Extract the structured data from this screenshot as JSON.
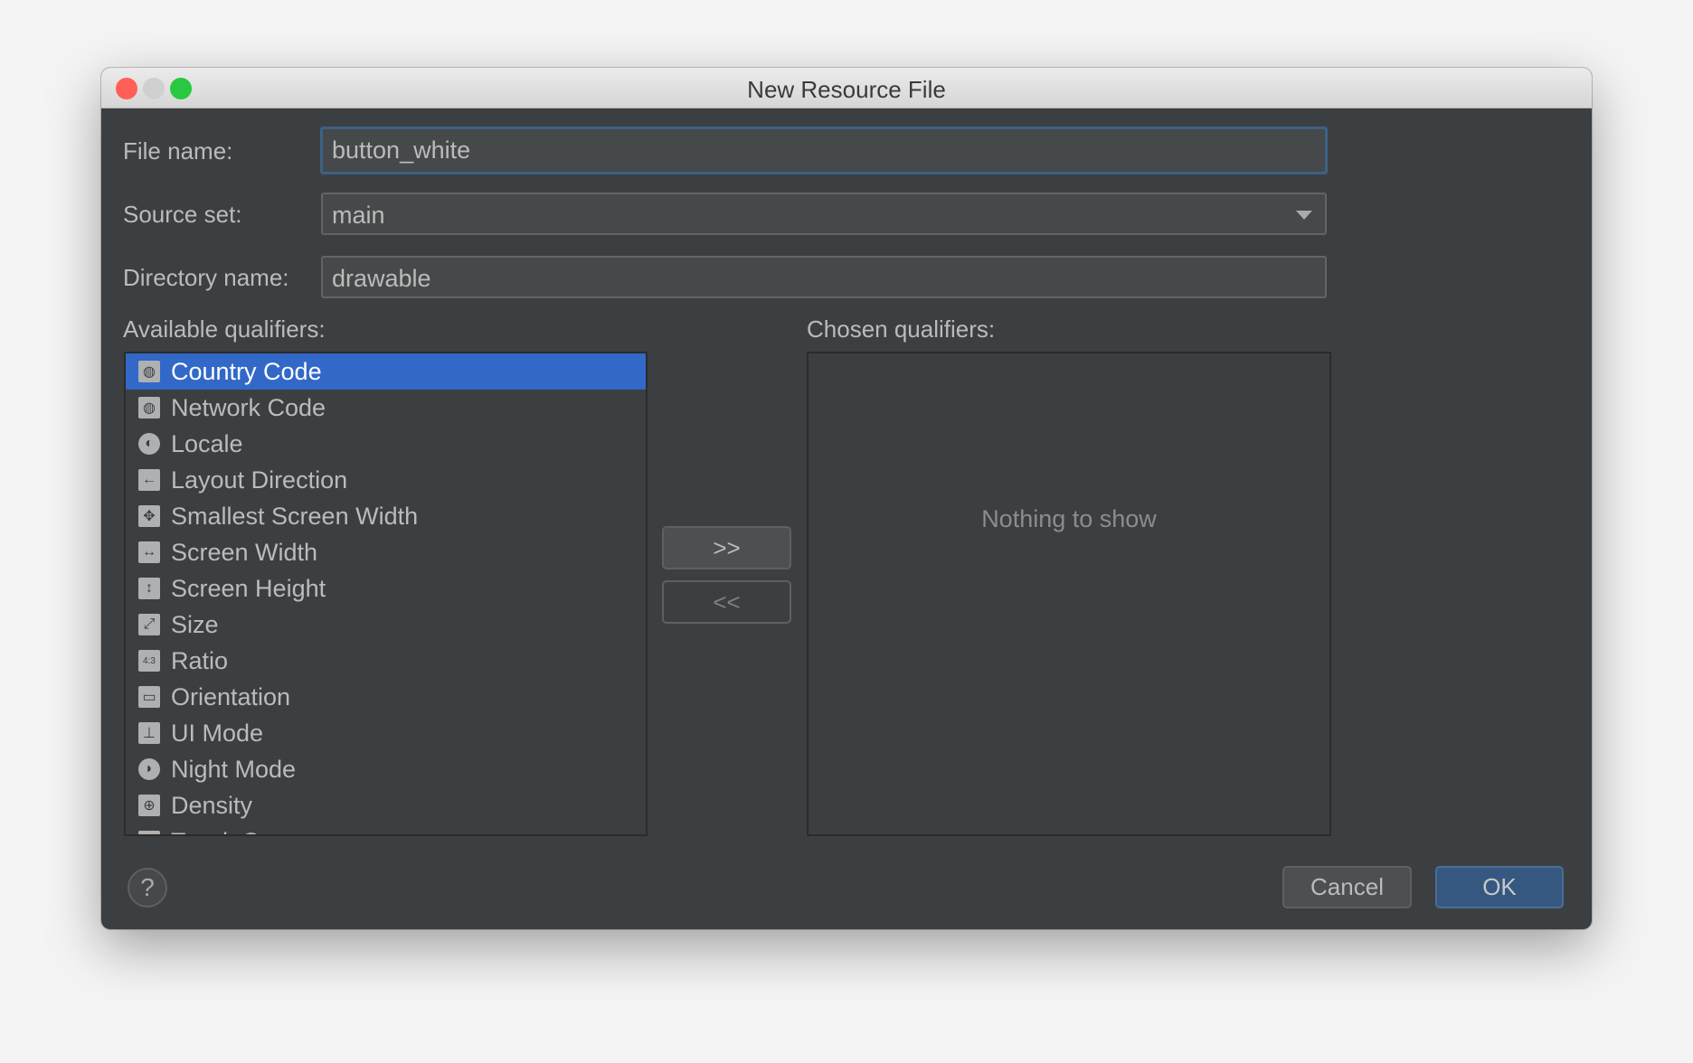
{
  "window": {
    "title": "New Resource File",
    "controls": {
      "close": "#ff5f57",
      "minimize": "#d0d0d0",
      "maximize": "#28c840"
    }
  },
  "form": {
    "file_name": {
      "label": "File name:",
      "value": "button_white"
    },
    "source_set": {
      "label": "Source set:",
      "value": "main"
    },
    "directory_name": {
      "label": "Directory name:",
      "value": "drawable"
    }
  },
  "available": {
    "label": "Available qualifiers:",
    "items": [
      {
        "label": "Country Code",
        "icon": "country-code-icon",
        "selected": true
      },
      {
        "label": "Network Code",
        "icon": "network-code-icon"
      },
      {
        "label": "Locale",
        "icon": "globe-icon"
      },
      {
        "label": "Layout Direction",
        "icon": "arrow-left-icon"
      },
      {
        "label": "Smallest Screen Width",
        "icon": "move-arrows-icon"
      },
      {
        "label": "Screen Width",
        "icon": "horizontal-arrows-icon"
      },
      {
        "label": "Screen Height",
        "icon": "vertical-arrows-icon"
      },
      {
        "label": "Size",
        "icon": "diagonal-arrows-icon"
      },
      {
        "label": "Ratio",
        "icon": "ratio-icon"
      },
      {
        "label": "Orientation",
        "icon": "orientation-icon"
      },
      {
        "label": "UI Mode",
        "icon": "ui-mode-icon"
      },
      {
        "label": "Night Mode",
        "icon": "moon-icon"
      },
      {
        "label": "Density",
        "icon": "density-icon"
      },
      {
        "label": "Touch Screen",
        "icon": "touch-icon"
      }
    ]
  },
  "transfer": {
    "add": ">>",
    "remove": "<<"
  },
  "chosen": {
    "label": "Chosen qualifiers:",
    "empty_text": "Nothing to show"
  },
  "footer": {
    "help": "?",
    "cancel": "Cancel",
    "ok": "OK"
  },
  "colors": {
    "accent": "#3268c8",
    "ok_button": "#365880"
  }
}
